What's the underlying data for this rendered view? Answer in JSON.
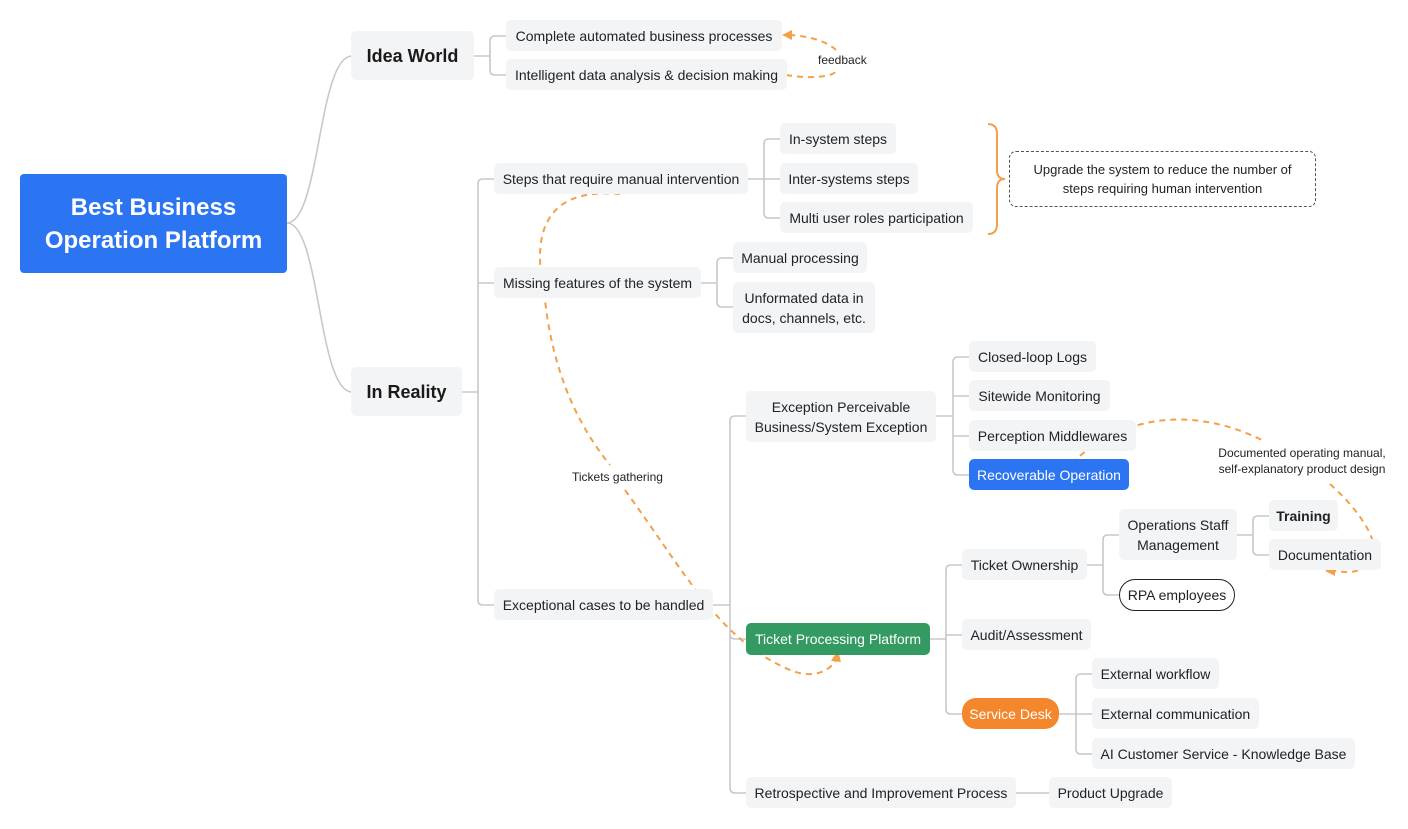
{
  "colors": {
    "root": "#2b74f2",
    "highlight_blue": "#2b74f2",
    "highlight_green": "#339a62",
    "highlight_orange": "#f4862b",
    "connector": "#c8c8c8",
    "relationship": "#f4a04a"
  },
  "mindmap": {
    "root": "Best Business Operation Platform",
    "idea_world": {
      "label": "Idea World",
      "children": [
        "Complete automated business processes",
        "Intelligent data analysis & decision making"
      ]
    },
    "in_reality": {
      "label": "In Reality",
      "steps": {
        "label": "Steps that require manual intervention",
        "children": [
          "In-system steps",
          "Inter-systems steps",
          "Multi user roles participation"
        ]
      },
      "missing": {
        "label": "Missing features of the system",
        "children": [
          "Manual processing",
          "Unformated data in docs, channels, etc."
        ]
      },
      "exceptional": {
        "label": "Exceptional cases to be handled",
        "perceivable": {
          "label": "Exception Perceivable Business/System Exception",
          "children": [
            "Closed-loop Logs",
            "Sitewide Monitoring",
            "Perception Middlewares",
            "Recoverable Operation"
          ]
        },
        "ticket_platform": {
          "label": "Ticket Processing Platform",
          "ownership": {
            "label": "Ticket Ownership",
            "staff": {
              "label": "Operations Staff Management",
              "children": [
                "Training",
                "Documentation"
              ]
            },
            "rpa": "RPA employees"
          },
          "audit": "Audit/Assessment",
          "service_desk": {
            "label": "Service Desk",
            "children": [
              "External workflow",
              "External communication",
              "AI Customer Service - Knowledge Base"
            ]
          }
        },
        "retrospective": {
          "label": "Retrospective and Improvement Process",
          "children": [
            "Product Upgrade"
          ]
        }
      }
    }
  },
  "summary_note": "Upgrade the system to reduce the number of steps requiring human intervention",
  "relationships": {
    "feedback": "feedback",
    "tickets_gathering": "Tickets gathering",
    "documented": "Documented operating manual, self-explanatory product design"
  }
}
